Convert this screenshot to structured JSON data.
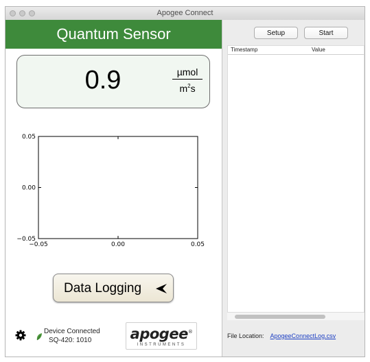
{
  "window": {
    "title": "Apogee Connect"
  },
  "sensor": {
    "title": "Quantum Sensor",
    "value": "0.9",
    "unit_numerator": "µmol",
    "unit_denominator_base": "m",
    "unit_denominator_sup": "2",
    "unit_denominator_tail": "s"
  },
  "chart_data": {
    "type": "line",
    "series": [],
    "x": [],
    "xlim": [
      -0.05,
      0.05
    ],
    "ylim": [
      -0.05,
      0.05
    ],
    "xticks": [
      "−0.05",
      "0.00",
      "0.05"
    ],
    "yticks": [
      "0.05",
      "0.00",
      "−0.05"
    ],
    "title": "",
    "xlabel": "",
    "ylabel": "",
    "grid": false
  },
  "logging_button": {
    "label": "Data Logging"
  },
  "status": {
    "line1": "Device Connected",
    "line2": "SQ-420: 1010"
  },
  "logo": {
    "word": "apogee",
    "sub": "INSTRUMENTS",
    "mark": "®"
  },
  "toolbar": {
    "setup_label": "Setup",
    "start_label": "Start"
  },
  "table": {
    "columns": [
      "Timestamp",
      "Value"
    ],
    "rows": []
  },
  "file": {
    "label": "File Location:",
    "link": "ApogeeConnectLog.csv"
  },
  "colors": {
    "header_green": "#3e8a3b",
    "link_blue": "#1a3dc2"
  }
}
